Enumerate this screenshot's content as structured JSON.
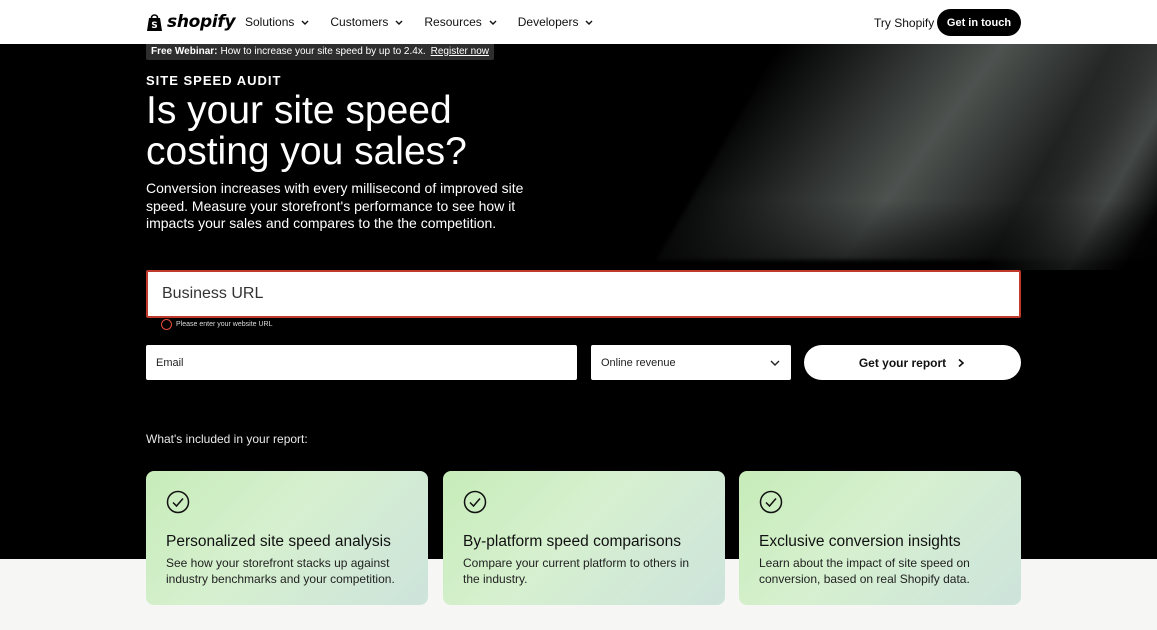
{
  "header": {
    "logo_text": "shopify",
    "nav": [
      "Solutions",
      "Customers",
      "Resources",
      "Developers"
    ],
    "try_label": "Try Shopify",
    "cta_label": "Get in touch"
  },
  "webinar": {
    "label": "Free Webinar:",
    "text": "How to increase your site speed by up to 2.4x.",
    "link": "Register now"
  },
  "hero": {
    "eyebrow": "SITE SPEED AUDIT",
    "headline": "Is your site speed costing you sales?",
    "subtext": "Conversion increases with every millisecond of improved site speed. Measure your storefront's performance to see how it impacts your sales and compares to the the competition."
  },
  "form": {
    "url_placeholder": "Business URL",
    "url_error": "Please enter your website URL",
    "email_placeholder": "Email",
    "revenue_selected": "Online revenue",
    "submit_label": "Get your report"
  },
  "included_label": "What's included in your report:",
  "cards": [
    {
      "title": "Personalized site speed analysis",
      "text": "See how your storefront stacks up against industry benchmarks and your competition."
    },
    {
      "title": "By-platform speed comparisons",
      "text": "Compare your current platform to others in the industry."
    },
    {
      "title": "Exclusive conversion insights",
      "text": "Learn about the impact of site speed on conversion, based on real Shopify data."
    }
  ],
  "colors": {
    "accent": "#000000",
    "error": "#c0392b",
    "card_green": "#c7ecb9"
  }
}
